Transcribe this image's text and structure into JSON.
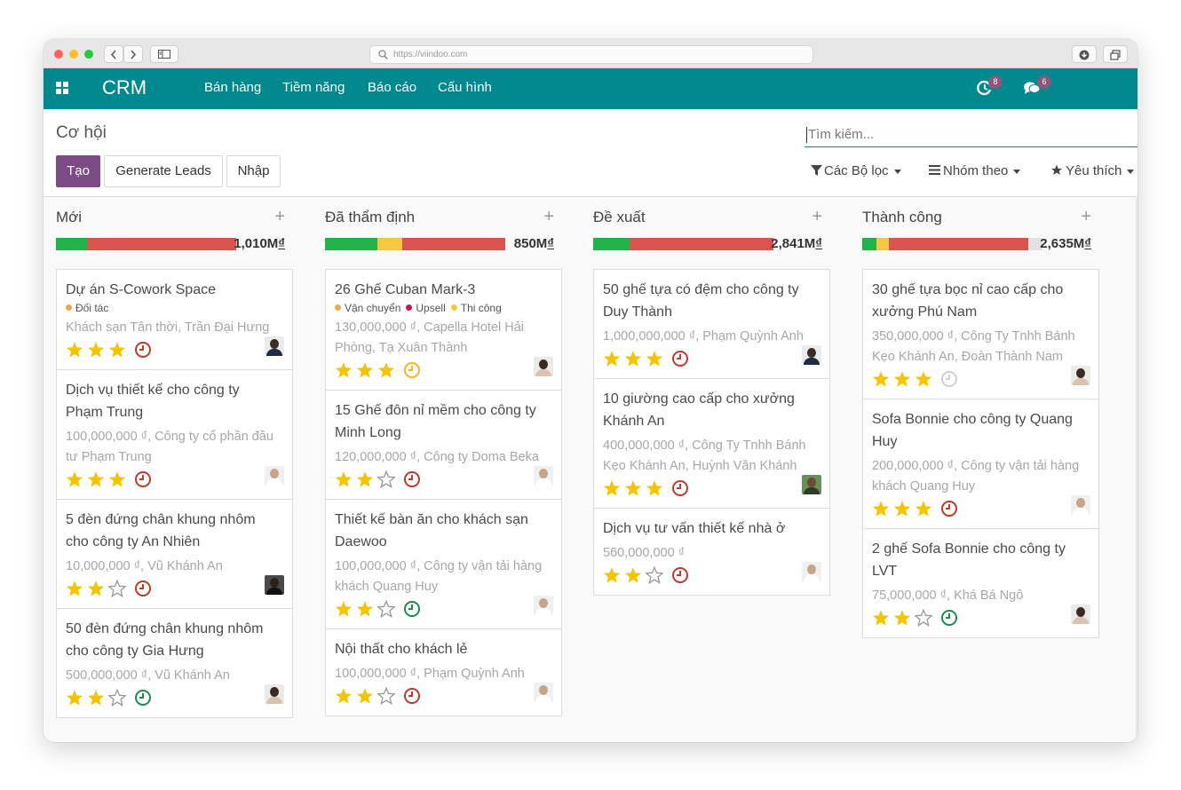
{
  "browser": {
    "url": "https://viindoo.com"
  },
  "navbar": {
    "brand": "CRM",
    "menus": [
      "Bán hàng",
      "Tiềm năng",
      "Báo cáo",
      "Cấu hình"
    ],
    "activity_count": "8",
    "message_count": "6",
    "badge_color": "#875a7b",
    "bar_color": "#00888f"
  },
  "control": {
    "breadcrumb": "Cơ hội",
    "create_label": "Tạo",
    "generate_label": "Generate Leads",
    "import_label": "Nhập",
    "search_placeholder": "Tìm kiếm...",
    "filters_label": "Các Bộ lọc",
    "groupby_label": "Nhóm theo",
    "favorites_label": "Yêu thích"
  },
  "columns": [
    {
      "title": "Mới",
      "total_value": "1,010M",
      "currency": "₫",
      "progress": [
        {
          "color": "#21b24a",
          "fraction": 0.17
        },
        {
          "color": "#d9534f",
          "fraction": 0.83
        }
      ],
      "cards": [
        {
          "title": "Dự án S-Cowork Space",
          "tags": [
            {
              "label": "Đối tác",
              "color": "#f0a64e"
            }
          ],
          "subtitle": "Khách sạn Tân thời, Trần Đại Hưng",
          "stars": 3,
          "activity": "overdue",
          "avatar": "man-dark"
        },
        {
          "title": "Dịch vụ thiết kế cho công ty Phạm Trung",
          "tags": [],
          "subtitle": "100,000,000 ₫, Công ty cổ phần đầu tư Phạm Trung",
          "stars": 3,
          "activity": "overdue",
          "avatar": "man-light"
        },
        {
          "title": "5 đèn đứng chân khung nhôm cho công ty An Nhiên",
          "tags": [],
          "subtitle": "10,000,000 ₫, Vũ Khánh An",
          "stars": 2,
          "activity": "overdue",
          "avatar": "man-black"
        },
        {
          "title": "50 đèn đứng chân khung nhôm cho công ty Gia Hưng",
          "tags": [],
          "subtitle": "500,000,000 ₫, Vũ Khánh An",
          "stars": 2,
          "activity": "planned",
          "avatar": "woman"
        }
      ]
    },
    {
      "title": "Đã thẩm định",
      "total_value": "850M",
      "currency": "₫",
      "progress": [
        {
          "color": "#21b24a",
          "fraction": 0.29
        },
        {
          "color": "#f5c842",
          "fraction": 0.14
        },
        {
          "color": "#d9534f",
          "fraction": 0.57
        }
      ],
      "cards": [
        {
          "title": "26 Ghế Cuban Mark-3",
          "tags": [
            {
              "label": "Vận chuyển",
              "color": "#f0a64e"
            },
            {
              "label": "Upsell",
              "color": "#c2185b"
            },
            {
              "label": "Thi công",
              "color": "#f5c842"
            }
          ],
          "subtitle": "130,000,000 ₫, Capella Hotel Hải Phòng, Tạ Xuân Thành",
          "stars": 3,
          "activity": "today",
          "avatar": "woman"
        },
        {
          "title": "15 Ghế đôn nỉ mềm cho công ty Minh Long",
          "tags": [],
          "subtitle": "120,000,000 ₫, Công ty Doma Beka",
          "stars": 2,
          "activity": "overdue",
          "avatar": "man-light"
        },
        {
          "title": "Thiết kế bàn ăn cho khách sạn Daewoo",
          "tags": [],
          "subtitle": "100,000,000 ₫, Công ty vận tải hàng khách Quang Huy",
          "stars": 2,
          "activity": "planned",
          "avatar": "man-light"
        },
        {
          "title": "Nội thất cho khách lẻ",
          "tags": [],
          "subtitle": "100,000,000 ₫, Phạm Quỳnh Anh",
          "stars": 2,
          "activity": "overdue",
          "avatar": "man-light"
        }
      ]
    },
    {
      "title": "Đề xuất",
      "total_value": "2,841M",
      "currency": "₫",
      "progress": [
        {
          "color": "#21b24a",
          "fraction": 0.2
        },
        {
          "color": "#d9534f",
          "fraction": 0.8
        }
      ],
      "cards": [
        {
          "title": "50 ghế tựa có đệm cho công ty Duy Thành",
          "tags": [],
          "subtitle": "1,000,000,000 ₫, Phạm Quỳnh Anh",
          "stars": 3,
          "activity": "overdue",
          "avatar": "man-dark"
        },
        {
          "title": "10 giường cao cấp cho xưởng Khánh An",
          "tags": [],
          "subtitle": "400,000,000 ₫, Công Ty Tnhh Bánh Kẹo Khánh An, Huỳnh Văn Khánh",
          "stars": 3,
          "activity": "overdue",
          "avatar": "man-green"
        },
        {
          "title": "Dịch vụ tư vấn thiết kế nhà ở",
          "tags": [],
          "subtitle": "560,000,000 ₫",
          "stars": 2,
          "activity": "overdue",
          "avatar": "man-light"
        }
      ]
    },
    {
      "title": "Thành công",
      "total_value": "2,635M",
      "currency": "₫",
      "progress": [
        {
          "color": "#21b24a",
          "fraction": 0.08
        },
        {
          "color": "#f5c842",
          "fraction": 0.07
        },
        {
          "color": "#d9534f",
          "fraction": 0.77
        },
        {
          "color": "#e2e2e2",
          "fraction": 0.08
        }
      ],
      "cards": [
        {
          "title": "30 ghế tựa bọc nỉ cao cấp cho xưởng Phú Nam",
          "tags": [],
          "subtitle": "350,000,000 ₫, Công Ty Tnhh Bánh Kẹo Khánh An, Đoàn Thành Nam",
          "stars": 3,
          "activity": "none",
          "avatar": "woman"
        },
        {
          "title": "Sofa Bonnie cho công ty Quang Huy",
          "tags": [],
          "subtitle": "200,000,000 ₫, Công ty vận tải hàng khách Quang Huy",
          "stars": 3,
          "activity": "overdue",
          "avatar": "man-light"
        },
        {
          "title": "2 ghế Sofa Bonnie cho công ty LVT",
          "tags": [],
          "subtitle": "75,000,000 ₫, Khá Bá Ngô",
          "stars": 2,
          "activity": "planned",
          "avatar": "woman"
        }
      ]
    }
  ],
  "activity_colors": {
    "overdue": "#c0392b",
    "today": "#f0b429",
    "planned": "#1e8a4c",
    "none": "#cfcfcf"
  },
  "star_color": "#f5c400"
}
